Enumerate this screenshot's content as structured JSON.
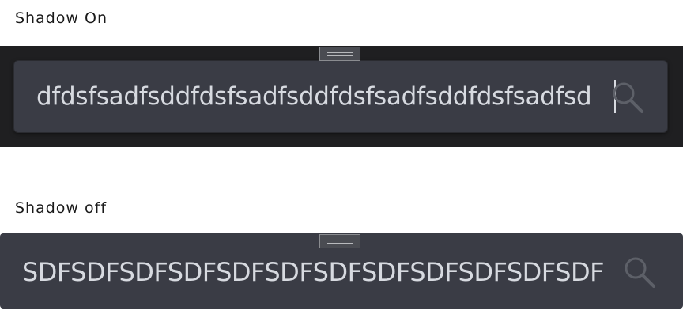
{
  "sections": [
    {
      "label": "Shadow On",
      "search_value": "dfdsfsadfsddfdsfsadfsddfdsfsadfsddfdsfsadfsd"
    },
    {
      "label": "Shadow off",
      "search_value": "DFSDFSDFSDFSDFSDFSDFSDFSDFSDFSDFSDFSDF"
    }
  ],
  "icons": {
    "search": "search-icon",
    "drag": "drag-handle-icon"
  },
  "colors": {
    "panel_dark": "#1f1f21",
    "input_bg": "#3a3c45",
    "text": "#d7dae0",
    "icon": "#5d6068"
  }
}
